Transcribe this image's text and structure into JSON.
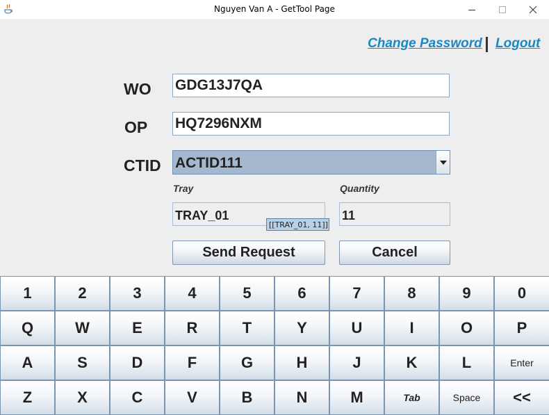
{
  "window": {
    "title": "Nguyen Van A - GetTool Page",
    "icons": [
      "java-app-icon",
      "minimize-icon",
      "maximize-icon",
      "close-icon"
    ]
  },
  "links": {
    "change_password": "Change Password",
    "logout": "Logout"
  },
  "form": {
    "wo_label": "WO",
    "wo_value": "GDG13J7QA",
    "op_label": "OP",
    "op_value": "HQ7296NXM",
    "ctid_label": "CTID",
    "ctid_value": "ACTID111",
    "tray_label": "Tray",
    "tray_value": "TRAY_01",
    "quantity_label": "Quantity",
    "quantity_value": "11",
    "tooltip": "[[TRAY_01, 11]]",
    "send_label": "Send Request",
    "cancel_label": "Cancel"
  },
  "keyboard": {
    "rows": [
      [
        "1",
        "2",
        "3",
        "4",
        "5",
        "6",
        "7",
        "8",
        "9",
        "0"
      ],
      [
        "Q",
        "W",
        "E",
        "R",
        "T",
        "Y",
        "U",
        "I",
        "O",
        "P"
      ],
      [
        "A",
        "S",
        "D",
        "F",
        "G",
        "H",
        "J",
        "K",
        "L",
        "Enter"
      ],
      [
        "Z",
        "X",
        "C",
        "V",
        "B",
        "N",
        "M",
        "Tab",
        "Space",
        "<<"
      ]
    ]
  },
  "colors": {
    "link": "#1a88c4",
    "combo_selected_bg": "#a6b8cd",
    "field_border": "#8fa6bd"
  }
}
